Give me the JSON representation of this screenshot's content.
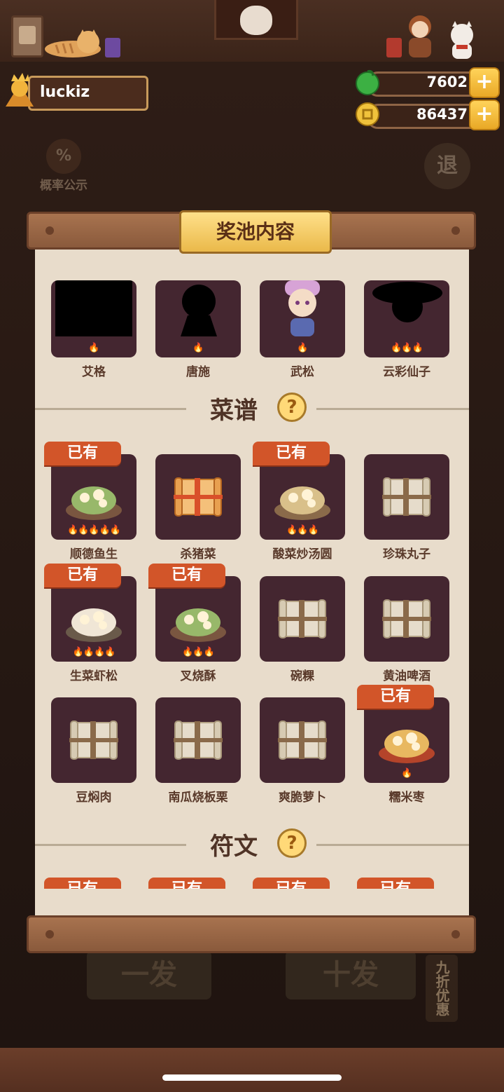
{
  "user": {
    "name": "luckiz"
  },
  "currency": {
    "gems": "7602",
    "coins": "86437",
    "plus": "+"
  },
  "background": {
    "probability_label": "概率公示",
    "probability_symbol": "%",
    "exit_label": "退",
    "draw_one_label": "一发",
    "draw_ten_label": "十发",
    "discount_label": "九折优惠"
  },
  "panel": {
    "title": "奖池内容",
    "top_items": [
      {
        "label": "艾格",
        "fires": "🔥"
      },
      {
        "label": "唐施",
        "fires": "🔥"
      },
      {
        "label": "武松",
        "fires": "🔥"
      },
      {
        "label": "云彩仙子",
        "fires": "🔥🔥🔥"
      }
    ],
    "recipes_section": {
      "title": "菜谱",
      "help": "?"
    },
    "recipes": [
      {
        "label": "顺德鱼生",
        "owned": "已有",
        "fires": "🔥🔥🔥🔥🔥"
      },
      {
        "label": "杀猪菜",
        "owned": "",
        "fires": ""
      },
      {
        "label": "酸菜炒汤圆",
        "owned": "已有",
        "fires": "🔥🔥🔥"
      },
      {
        "label": "珍珠丸子",
        "owned": "",
        "fires": ""
      },
      {
        "label": "生菜虾松",
        "owned": "已有",
        "fires": "🔥🔥🔥🔥"
      },
      {
        "label": "叉烧酥",
        "owned": "已有",
        "fires": "🔥🔥🔥"
      },
      {
        "label": "碗粿",
        "owned": "",
        "fires": ""
      },
      {
        "label": "黄油啤酒",
        "owned": "",
        "fires": ""
      },
      {
        "label": "豆焖肉",
        "owned": "",
        "fires": ""
      },
      {
        "label": "南瓜烧板栗",
        "owned": "",
        "fires": ""
      },
      {
        "label": "爽脆萝卜",
        "owned": "",
        "fires": ""
      },
      {
        "label": "糯米枣",
        "owned": "已有",
        "fires": "🔥"
      }
    ],
    "runes_section": {
      "title": "符文",
      "help": "?"
    },
    "rune_badges": [
      "已有",
      "已有",
      "已有",
      "已有"
    ]
  },
  "colors": {
    "owned_badge": "#d25529",
    "tile": "#442630",
    "panel": "#e8dccb",
    "title_plate": "#eab94a"
  }
}
